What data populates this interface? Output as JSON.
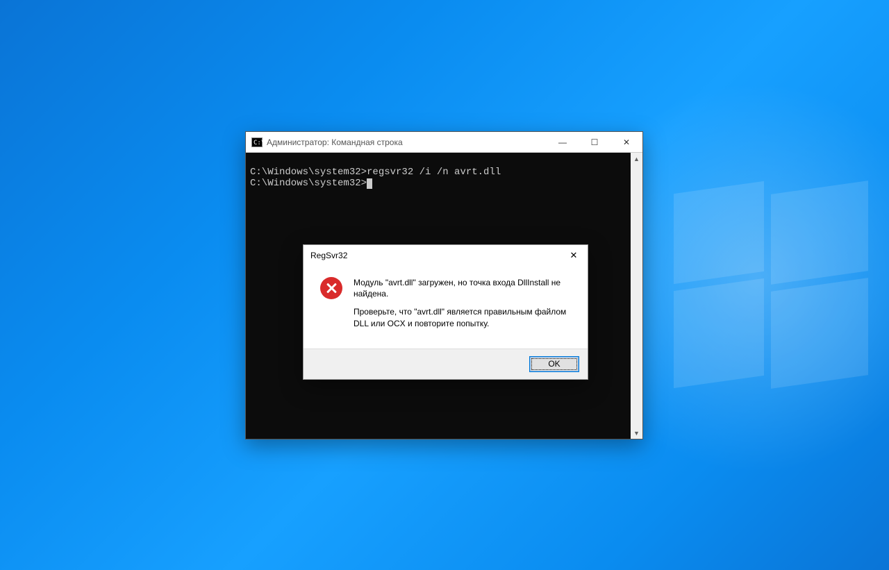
{
  "cmd": {
    "title": "Администратор: Командная строка",
    "icon_glyph": "C:\\",
    "lines": [
      "C:\\Windows\\system32>regsvr32 /i /n avrt.dll",
      "",
      "C:\\Windows\\system32>"
    ],
    "buttons": {
      "minimize": "—",
      "maximize": "☐",
      "close": "✕"
    },
    "scroll_up": "▲",
    "scroll_down": "▼"
  },
  "dialog": {
    "title": "RegSvr32",
    "close": "✕",
    "msg1": "Модуль \"avrt.dll\" загружен, но точка входа DllInstall не найдена.",
    "msg2": "Проверьте, что \"avrt.dll\" является правильным файлом DLL или OCX и повторите попытку.",
    "ok": "OK"
  }
}
